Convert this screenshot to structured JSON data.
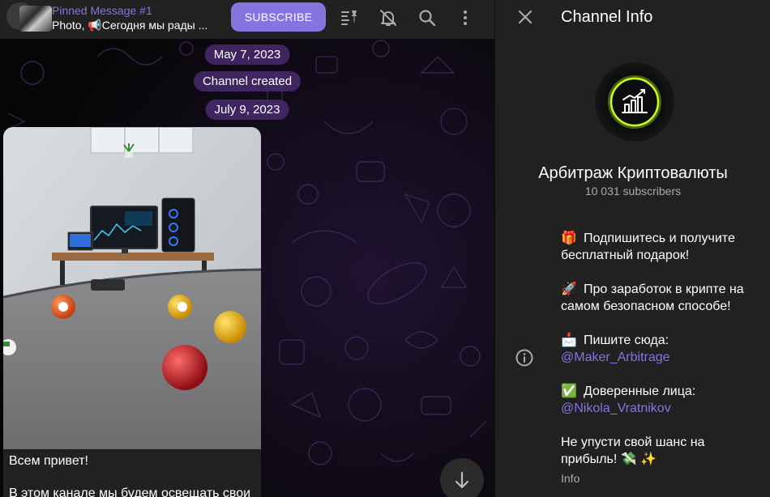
{
  "header": {
    "pinned_title": "Pinned Message #1",
    "pinned_prefix": "Photo, ",
    "pinned_text": "📢Сегодня мы рады ...",
    "subscribe_label": "SUBSCRIBE",
    "icons": [
      "pinned-list-icon",
      "mute-bell-icon",
      "search-icon",
      "more-vertical-icon"
    ]
  },
  "chat": {
    "date_1": "May 7, 2023",
    "service_text": "Channel created",
    "date_2": "July 9, 2023",
    "message": {
      "line_1": "Всем привет!",
      "line_2": "В этом канале мы будем освещать свои"
    }
  },
  "panel": {
    "title": "Channel Info",
    "channel_name": "Арбитраж Криптовалюты",
    "subscribers": "10 031 subscribers",
    "desc": {
      "p1_emoji": "🎁",
      "p1": "Подпишитесь и получите бесплатный подарок!",
      "p2_emoji": "🚀",
      "p2": "Про заработок в крипте на самом безопасном способе!",
      "p3_emoji": "📩",
      "p3": "Пишите сюда:",
      "p3_link": "@Maker_Arbitrage",
      "p4_emoji": "✅",
      "p4": "Доверенные лица:",
      "p4_link": "@Nikola_Vratnikov",
      "p5": "Не упусти свой шанс на прибыль! 💸 ✨",
      "label": "Info"
    }
  },
  "colors": {
    "accent": "#8774e1",
    "panel_bg": "#212121",
    "date_pill": "#482a6e",
    "avatar_ring": "#c6ff1a"
  }
}
